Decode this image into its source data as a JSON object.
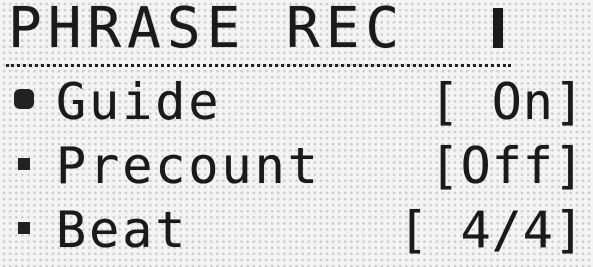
{
  "screen": {
    "title": "PHRASE REC"
  },
  "menu": {
    "items": [
      {
        "label": "Guide",
        "value": "[ On]",
        "selected": true
      },
      {
        "label": "Precount",
        "value": "[Off]",
        "selected": false
      },
      {
        "label": "Beat",
        "value": "[ 4/4]",
        "selected": false
      }
    ]
  },
  "colors": {
    "lcd_background": "#f4f4f4",
    "pixel_on": "#1a1a1a"
  }
}
